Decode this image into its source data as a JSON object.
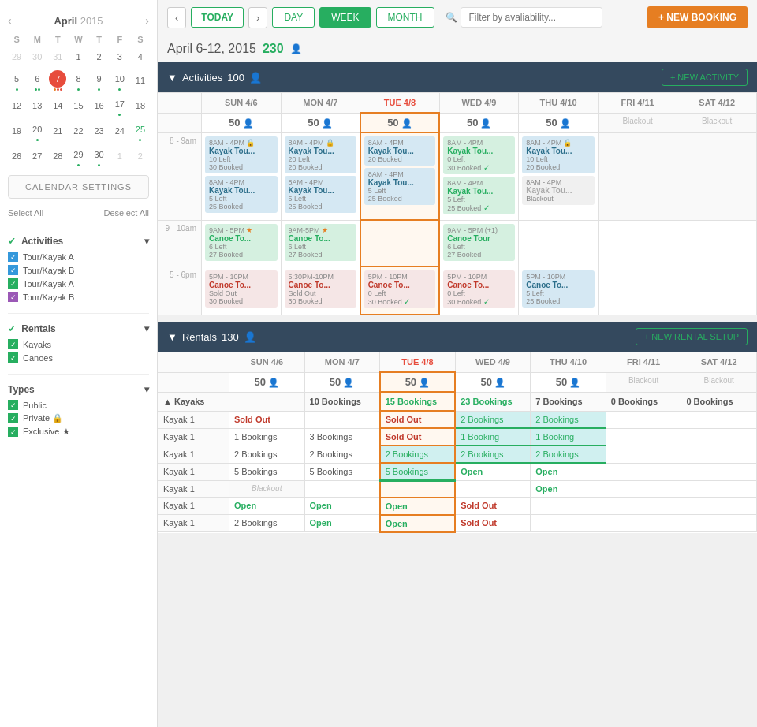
{
  "sidebar": {
    "month": "April",
    "year": "2015",
    "calendar_settings": "CALENDAR SETTINGS",
    "select_all": "Select All",
    "deselect_all": "Deselect All",
    "sections": [
      {
        "id": "activities",
        "label": "Activities",
        "items": [
          {
            "label": "Tour/Kayak A",
            "color": "blue"
          },
          {
            "label": "Tour/Kayak B",
            "color": "blue"
          },
          {
            "label": "Tour/Kayak A",
            "color": "green"
          },
          {
            "label": "Tour/Kayak B",
            "color": "purple"
          }
        ]
      },
      {
        "id": "rentals",
        "label": "Rentals",
        "items": [
          {
            "label": "Kayaks",
            "color": "green"
          },
          {
            "label": "Canoes",
            "color": "green"
          }
        ]
      },
      {
        "id": "types",
        "label": "Types",
        "items": [
          {
            "label": "Public",
            "color": "green",
            "suffix": ""
          },
          {
            "label": "Private",
            "color": "green",
            "suffix": "🔒"
          },
          {
            "label": "Exclusive",
            "color": "green",
            "suffix": "★"
          }
        ]
      }
    ],
    "week_days": [
      "S",
      "M",
      "T",
      "W",
      "T",
      "F",
      "S"
    ],
    "cal_weeks": [
      [
        {
          "d": "29",
          "m": "prev"
        },
        {
          "d": "30",
          "m": "prev"
        },
        {
          "d": "31",
          "m": "prev"
        },
        {
          "d": "1",
          "m": "curr"
        },
        {
          "d": "2",
          "m": "curr"
        },
        {
          "d": "3",
          "m": "curr"
        },
        {
          "d": "4",
          "m": "curr"
        }
      ],
      [
        {
          "d": "5",
          "m": "curr",
          "dots": [
            "g"
          ]
        },
        {
          "d": "6",
          "m": "curr",
          "dots": [
            "g",
            "g"
          ]
        },
        {
          "d": "7",
          "m": "curr",
          "today": true,
          "dots": [
            "o",
            "r",
            "r"
          ]
        },
        {
          "d": "8",
          "m": "curr",
          "dots": [
            "g"
          ]
        },
        {
          "d": "9",
          "m": "curr",
          "dots": [
            "g"
          ]
        },
        {
          "d": "10",
          "m": "curr",
          "dots": [
            "g"
          ]
        },
        {
          "d": "11",
          "m": "curr"
        }
      ],
      [
        {
          "d": "12"
        },
        {
          "d": "13"
        },
        {
          "d": "14"
        },
        {
          "d": "15"
        },
        {
          "d": "16"
        },
        {
          "d": "17",
          "dots": [
            "g"
          ]
        },
        {
          "d": "18"
        }
      ],
      [
        {
          "d": "19"
        },
        {
          "d": "20",
          "dots": [
            "g"
          ]
        },
        {
          "d": "21"
        },
        {
          "d": "22"
        },
        {
          "d": "23"
        },
        {
          "d": "24"
        },
        {
          "d": "25",
          "dots": [
            "g"
          ]
        }
      ],
      [
        {
          "d": "26"
        },
        {
          "d": "27"
        },
        {
          "d": "28"
        },
        {
          "d": "29",
          "dots": [
            "g"
          ]
        },
        {
          "d": "30",
          "dots": [
            "g"
          ]
        },
        {
          "d": "1",
          "m": "next"
        },
        {
          "d": "2",
          "m": "next"
        }
      ]
    ]
  },
  "toolbar": {
    "today_label": "TODAY",
    "day_label": "DAY",
    "week_label": "WEEK",
    "month_label": "MONTH",
    "filter_placeholder": "Filter by avaliability...",
    "new_booking_label": "+ NEW BOOKING"
  },
  "main": {
    "date_range": "April 6-12, 2015",
    "count": "230",
    "activities_label": "Activities",
    "activities_count": "100",
    "new_activity_label": "+ NEW ACTIVITY",
    "rentals_label": "Rentals",
    "rentals_count": "130",
    "new_rental_label": "+ NEW RENTAL SETUP",
    "col_headers": [
      {
        "label": "SUN 4/6",
        "today": false
      },
      {
        "label": "MON 4/7",
        "today": false
      },
      {
        "label": "TUE 4/8",
        "today": true
      },
      {
        "label": "WED 4/9",
        "today": false
      },
      {
        "label": "THU 4/10",
        "today": false
      },
      {
        "label": "FRI 4/11",
        "today": false
      },
      {
        "label": "SAT 4/12",
        "today": false
      }
    ],
    "activity_rows": [
      {
        "time": "8 - 9am",
        "slots": [
          {
            "cards": [
              {
                "time": "8AM - 4PM",
                "lock": true,
                "name": "Kayak Tou...",
                "detail1": "10 Left",
                "detail2": "30 Booked",
                "type": "blue"
              },
              {
                "time": "8AM - 4PM",
                "name": "Kayak Tou...",
                "detail1": "5 Left",
                "detail2": "25 Booked",
                "type": "blue"
              }
            ]
          },
          {
            "cards": [
              {
                "time": "8AM - 4PM",
                "lock": true,
                "name": "Kayak Tou...",
                "detail1": "20 Left",
                "detail2": "20 Booked",
                "type": "blue"
              },
              {
                "time": "8AM - 4PM",
                "name": "Kayak Tou...",
                "detail1": "5 Left",
                "detail2": "25 Booked",
                "type": "blue"
              }
            ]
          },
          {
            "today": true,
            "cards": [
              {
                "time": "8AM - 4PM",
                "name": "Kayak Tou...",
                "detail1": "20 Booked",
                "type": "blue"
              },
              {
                "time": "8AM - 4PM",
                "name": "Kayak Tou...",
                "detail1": "5 Left",
                "detail2": "25 Booked",
                "type": "blue"
              }
            ]
          },
          {
            "cards": [
              {
                "time": "8AM - 4PM",
                "name": "Kayak Tou...",
                "detail1": "0 Left",
                "detail2": "30 Booked",
                "check": true,
                "type": "blue"
              },
              {
                "time": "8AM - 4PM",
                "name": "Kayak Tou...",
                "detail1": "5 Left",
                "detail2": "25 Booked",
                "check": true,
                "type": "blue"
              }
            ]
          },
          {
            "cards": [
              {
                "time": "8AM - 4PM",
                "lock": true,
                "name": "Kayak Tou...",
                "detail1": "10 Left",
                "detail2": "20 Booked",
                "type": "blue"
              },
              {
                "time": "8AM - 4PM",
                "name": "Kayak Tou...",
                "detail1": "Blackout",
                "type": "blackout"
              }
            ]
          },
          {
            "blackout": true
          },
          {
            "blackout": true
          }
        ]
      },
      {
        "time": "9 - 10am",
        "slots": [
          {
            "cards": [
              {
                "time": "9AM - 5PM",
                "star": true,
                "name": "Canoe To...",
                "detail1": "6 Left",
                "detail2": "27 Booked",
                "type": "green"
              }
            ]
          },
          {
            "cards": [
              {
                "time": "9AM-5PM",
                "star": true,
                "name": "Canoe To...",
                "detail1": "6 Left",
                "detail2": "27 Booked",
                "type": "green"
              }
            ]
          },
          {
            "today": true,
            "cards": []
          },
          {
            "cards": [
              {
                "time": "9AM - 5PM (+1)",
                "name": "Canoe Tour",
                "detail1": "6 Left",
                "detail2": "27 Booked",
                "type": "green"
              }
            ]
          },
          {
            "cards": []
          },
          {
            "blackout": false,
            "cards": []
          },
          {
            "blackout": false,
            "cards": []
          }
        ]
      },
      {
        "time": "5 - 6pm",
        "slots": [
          {
            "cards": [
              {
                "time": "5PM - 10PM",
                "name": "Canoe To...",
                "detail1": "Sold Out",
                "detail2": "30 Booked",
                "type": "sold-out"
              }
            ]
          },
          {
            "cards": [
              {
                "time": "5:30PM-10PM",
                "name": "Canoe To...",
                "detail1": "Sold Out",
                "detail2": "30 Booked",
                "type": "sold-out"
              }
            ]
          },
          {
            "today": true,
            "cards": [
              {
                "time": "5PM - 10PM",
                "name": "Canoe To...",
                "detail1": "0 Left",
                "detail2": "30 Booked",
                "check": true,
                "type": "sold-out"
              }
            ]
          },
          {
            "cards": [
              {
                "time": "5PM - 10PM",
                "name": "Canoe To...",
                "detail1": "0 Left",
                "detail2": "30 Booked",
                "check": true,
                "type": "sold-out"
              }
            ]
          },
          {
            "cards": [
              {
                "time": "5PM - 10PM",
                "name": "Canoe To...",
                "detail1": "5 Left",
                "detail2": "25 Booked",
                "type": "blue"
              }
            ]
          },
          {
            "blackout": false,
            "cards": []
          },
          {
            "blackout": false,
            "cards": []
          }
        ]
      }
    ],
    "capacity_row": [
      50,
      50,
      50,
      50,
      50,
      null,
      null
    ],
    "rentals_capacity_row": [
      50,
      50,
      50,
      50,
      50,
      null,
      null
    ],
    "kayak_header": {
      "label": "Kayaks",
      "bookings": [
        null,
        "10 Bookings",
        "10 Bookings",
        "15 Bookings",
        "23 Bookings",
        "7 Bookings",
        "0 Bookings",
        "0 Bookings"
      ]
    },
    "kayak_rows": [
      [
        "Kayak 1",
        "Sold Out",
        "",
        "Sold Out",
        "2 Bookings",
        "2 Bookings",
        "",
        ""
      ],
      [
        "Kayak 1",
        "1 Bookings",
        "3 Bookings",
        "Sold Out",
        "1 Booking",
        "1 Booking",
        "",
        ""
      ],
      [
        "Kayak 1",
        "2 Bookings",
        "2 Bookings",
        "2 Bookings",
        "2 Bookings",
        "2 Bookings",
        "",
        ""
      ],
      [
        "Kayak 1",
        "5 Bookings",
        "5 Bookings",
        "5 Bookings",
        "Open",
        "Open",
        "",
        ""
      ],
      [
        "Kayak 1",
        "Blackout",
        "",
        "",
        "",
        "Open",
        "",
        ""
      ],
      [
        "Kayak 1",
        "Open",
        "Open",
        "Open",
        "Sold Out",
        "",
        "",
        ""
      ],
      [
        "Kayak 1",
        "2 Bookings",
        "Open",
        "Open",
        "Sold Out",
        "",
        "",
        ""
      ]
    ]
  }
}
